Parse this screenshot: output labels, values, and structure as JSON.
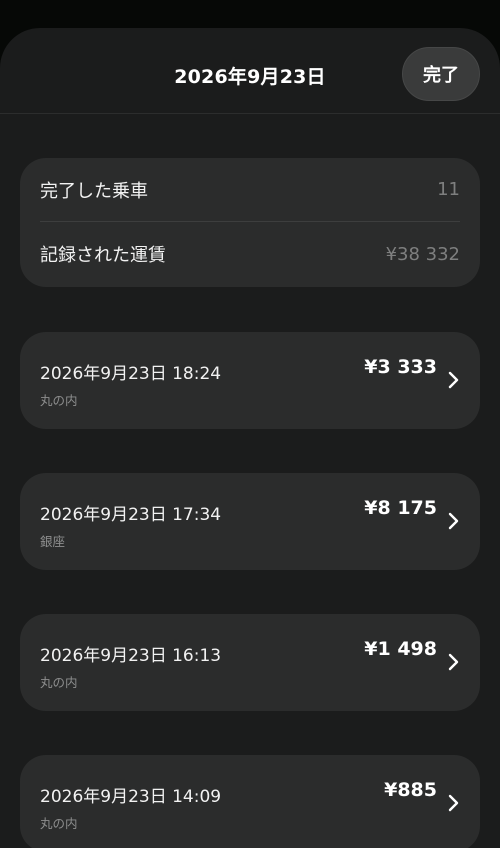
{
  "header": {
    "title": "2026年9月23日",
    "done_label": "完了"
  },
  "summary": {
    "rides_label": "完了した乗車",
    "rides_value": "11",
    "fare_label": "記録された運賃",
    "fare_value": "¥38 332"
  },
  "trips": [
    {
      "datetime": "2026年9月23日 18:24",
      "station": "丸の内",
      "fare": "¥3 333"
    },
    {
      "datetime": "2026年9月23日 17:34",
      "station": "銀座",
      "fare": "¥8 175"
    },
    {
      "datetime": "2026年9月23日 16:13",
      "station": "丸の内",
      "fare": "¥1 498"
    },
    {
      "datetime": "2026年9月23日 14:09",
      "station": "丸の内",
      "fare": "¥885"
    }
  ],
  "icons": {
    "trip_chevron": "chevron-right-icon"
  },
  "colors": {
    "background": "#1b1c1c",
    "card": "#2b2c2c",
    "text": "#ffffff",
    "muted": "#7e7f7f"
  }
}
